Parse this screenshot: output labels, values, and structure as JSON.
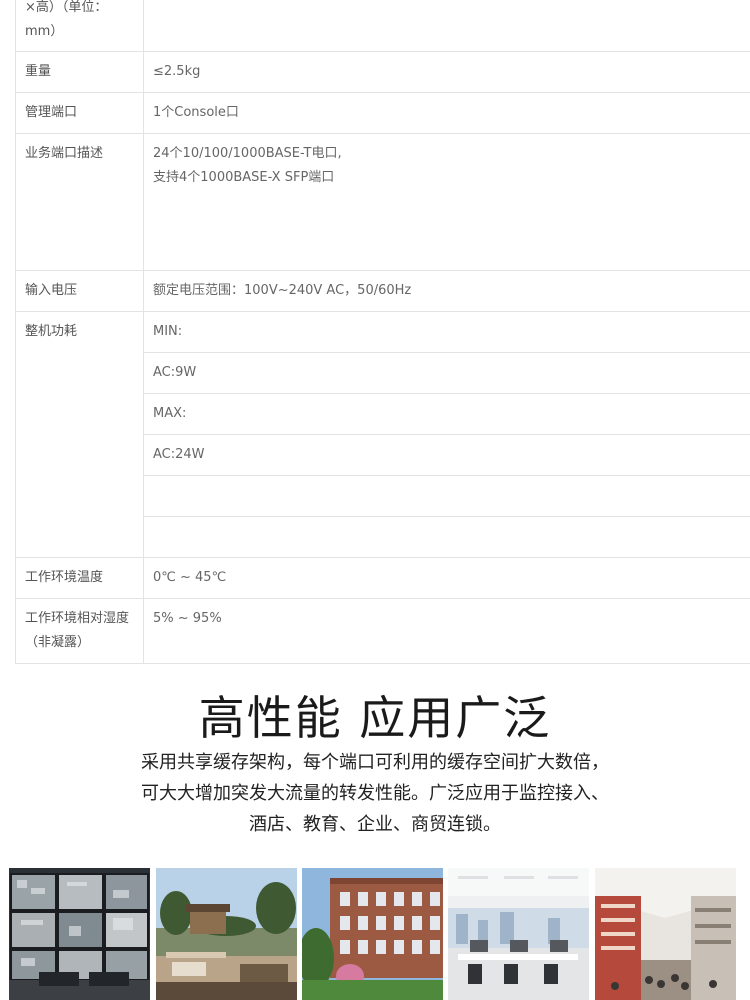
{
  "specs": {
    "dimension_label_line1": "×高）（单位：",
    "dimension_label_line2": "mm）",
    "weight_label": "重量",
    "weight_value": "≤2.5kg",
    "mgmt_label": "管理端口",
    "mgmt_value": "1个Console口",
    "ports_label": "业务端口描述",
    "ports_value_line1": "24个10/100/1000BASE-T电口,",
    "ports_value_line2": "支持4个1000BASE-X SFP端口",
    "voltage_label": "输入电压",
    "voltage_value": "额定电压范围：100V~240V AC，50/60Hz",
    "power_label": "整机功耗",
    "power_values": [
      "MIN:",
      "AC:9W",
      "MAX:",
      "AC:24W"
    ],
    "temp_label": "工作环境温度",
    "temp_value": "0℃ ~ 45℃",
    "humidity_label_line1": "工作环境相对湿度",
    "humidity_label_line2": "（非凝露）",
    "humidity_value": "5% ~ 95%"
  },
  "promo": {
    "headline": "高性能 应用广泛",
    "desc_line1": "采用共享缓存架构，每个端口可利用的缓存空间扩大数倍，",
    "desc_line2": "可大大增加突发大流量的转发性能。广泛应用于监控接入、",
    "desc_line3": "酒店、教育、企业、商贸连锁。"
  },
  "photos": [
    {
      "icon": "surveillance-video-wall"
    },
    {
      "icon": "hotel-resort"
    },
    {
      "icon": "campus-building"
    },
    {
      "icon": "office-interior"
    },
    {
      "icon": "shopping-mall"
    }
  ]
}
